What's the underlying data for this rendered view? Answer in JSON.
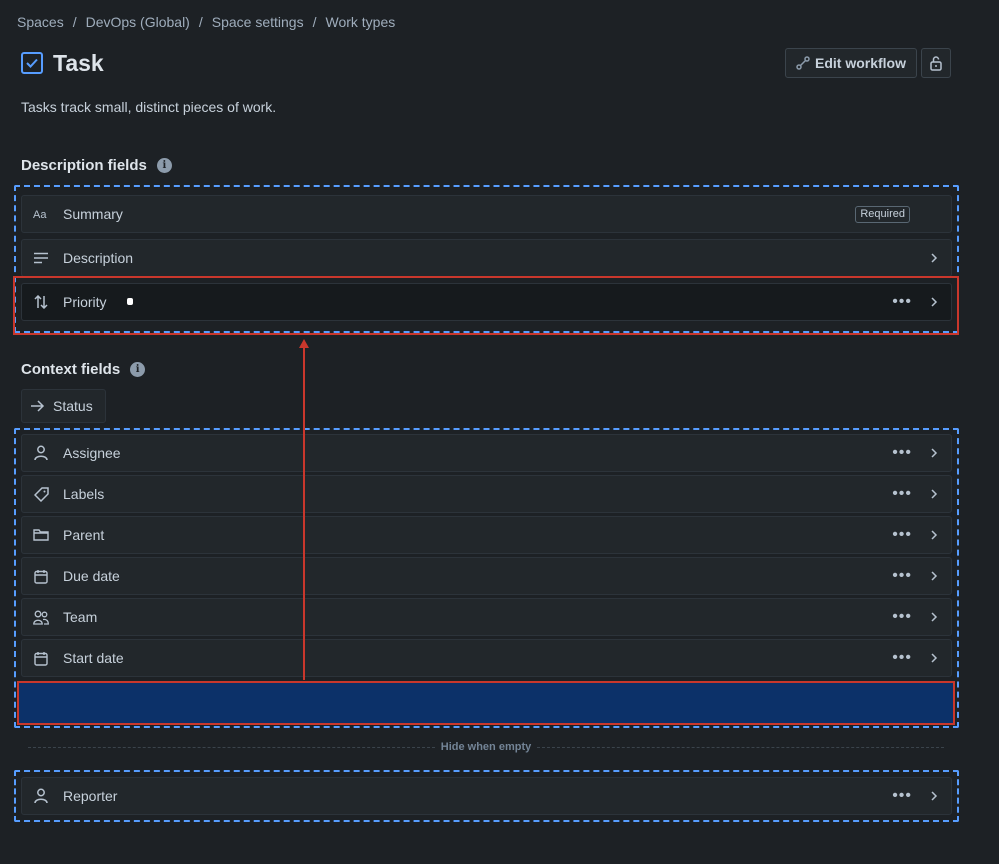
{
  "breadcrumb": [
    "Spaces",
    "DevOps (Global)",
    "Space settings",
    "Work types"
  ],
  "breadcrumb_separator": "/",
  "page": {
    "title": "Task",
    "description": "Tasks track small, distinct pieces of work.",
    "edit_workflow_label": "Edit workflow"
  },
  "description_section": {
    "title": "Description fields",
    "fields": [
      {
        "label": "Summary",
        "icon": "text-icon",
        "badge": "Required"
      },
      {
        "label": "Description",
        "icon": "lines-icon"
      },
      {
        "label": "Priority",
        "icon": "sort-arrows-icon"
      }
    ]
  },
  "context_section": {
    "title": "Context fields",
    "status_label": "Status",
    "fields": [
      {
        "label": "Assignee",
        "icon": "person-icon"
      },
      {
        "label": "Labels",
        "icon": "tag-icon"
      },
      {
        "label": "Parent",
        "icon": "folder-icon"
      },
      {
        "label": "Due date",
        "icon": "calendar-icon"
      },
      {
        "label": "Team",
        "icon": "people-icon"
      },
      {
        "label": "Start date",
        "icon": "calendar-icon"
      }
    ]
  },
  "hide_when_empty_label": "Hide when empty",
  "hidden_fields": [
    {
      "label": "Reporter",
      "icon": "person-icon"
    }
  ],
  "colors": {
    "background": "#1d2125",
    "accent": "#579dff",
    "highlight": "#c9372c",
    "drop_target": "#0c3169"
  }
}
